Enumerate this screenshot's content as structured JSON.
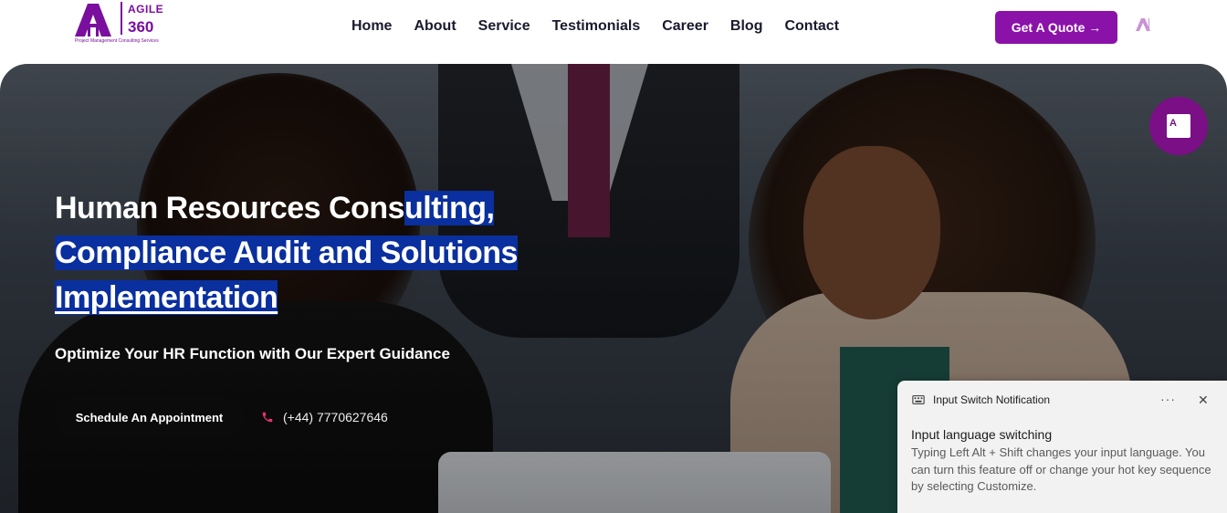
{
  "brand": {
    "name": "AGILE",
    "number": "360",
    "tagline": "Project Management Consulting Services",
    "accent_color": "#8a12a8"
  },
  "nav": {
    "items": [
      "Home",
      "About",
      "Service",
      "Testimonials",
      "Career",
      "Blog",
      "Contact"
    ]
  },
  "header": {
    "quote_button": "Get A Quote →"
  },
  "hero": {
    "title_line1_plain": "Human Resources Cons",
    "title_line1_hl": "ulting,",
    "title_line2": "Compliance Audit and Solutions",
    "title_line3": "Implementation",
    "subtitle": "Optimize Your HR Function with Our Expert Guidance",
    "appointment_button": "Schedule An Appointment",
    "phone": "(+44) 7770627646",
    "highlight_color": "#0a2f9e"
  },
  "notification": {
    "app_name": "Input Switch Notification",
    "title": "Input language switching",
    "body": "Typing Left Alt + Shift changes your input language. You can turn this feature off or change your hot key sequence by selecting Customize.",
    "more_icon": "ellipsis-icon",
    "close_icon": "close-icon"
  }
}
